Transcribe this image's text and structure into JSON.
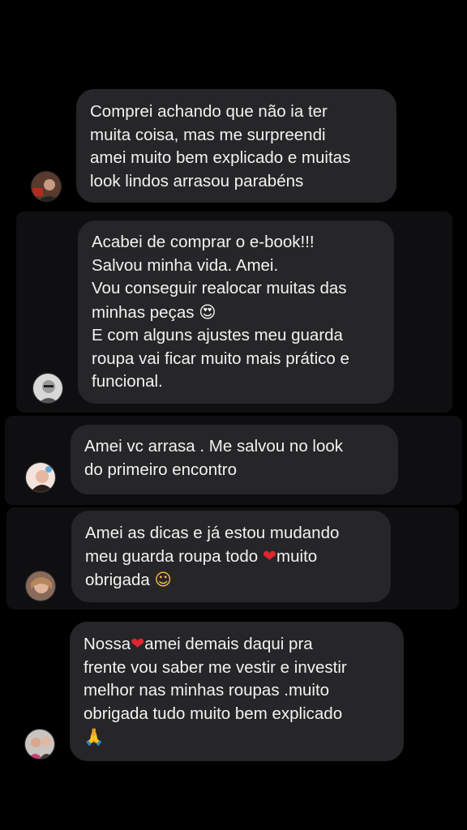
{
  "messages": [
    {
      "lines": [
        "Comprei achando que não ia ter",
        "muita coisa, mas me surpreendi",
        "amei muito bem explicado e muitas",
        "look lindos arrasou parabéns"
      ]
    },
    {
      "lines": [
        "Acabei de comprar o e-book!!!",
        "Salvou minha vida. Amei.",
        "Vou conseguir realocar muitas das",
        "minhas peças",
        "E com alguns ajustes meu guarda",
        "roupa vai ficar muito mais prático e",
        "funcional."
      ],
      "emoji": "😍"
    },
    {
      "lines": [
        "Amei vc arrasa . Me salvou no look",
        "do primeiro encontro"
      ]
    },
    {
      "lines": [
        "Amei as dicas e já estou mudando",
        "meu guarda roupa todo",
        "muito",
        "obrigada"
      ],
      "heart": "❤",
      "emoji": "☺"
    },
    {
      "lines": [
        "Nossa",
        "amei demais daqui pra",
        "frente vou saber me vestir e investir",
        "melhor nas minhas roupas .muito",
        "obrigada tudo muito bem explicado"
      ],
      "heart": "❤",
      "emoji": "🙏"
    }
  ]
}
